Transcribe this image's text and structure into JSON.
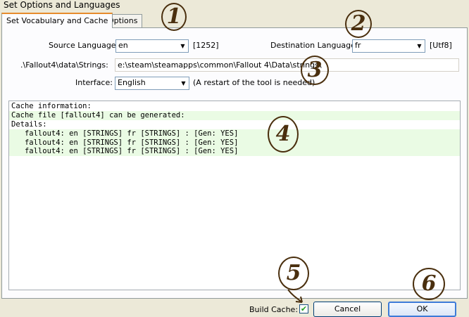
{
  "window": {
    "title": "Set Options and Languages"
  },
  "tabs": [
    {
      "label": "Set Vocabulary and Cache",
      "active": true
    },
    {
      "label": "Options",
      "active": false
    }
  ],
  "form": {
    "source_language_label": "Source Language:",
    "source_language_value": "en",
    "source_codepage": "[1252]",
    "destination_language_label": "Destination Language:",
    "destination_language_value": "fr",
    "destination_codepage": "[Utf8]",
    "strings_path_label": ".\\Fallout4\\data\\Strings:",
    "strings_path_value": "e:\\steam\\steamapps\\common\\Fallout 4\\Data\\strings\\",
    "interface_label": "Interface:",
    "interface_value": "English",
    "interface_note": "(A restart of the tool is needed)"
  },
  "cache": {
    "lines": [
      {
        "text": "Cache information:",
        "highlight": false
      },
      {
        "text": "Cache file [fallout4] can be generated:",
        "highlight": true
      },
      {
        "text": "Details:",
        "highlight": false
      },
      {
        "text": "   fallout4: en [STRINGS] fr [STRINGS] : [Gen: YES]",
        "highlight": true
      },
      {
        "text": "   fallout4: en [STRINGS] fr [STRINGS] : [Gen: YES]",
        "highlight": true
      },
      {
        "text": "   fallout4: en [STRINGS] fr [STRINGS] : [Gen: YES]",
        "highlight": true
      }
    ]
  },
  "footer": {
    "build_cache_label": "Build Cache:",
    "build_cache_checked": true,
    "cancel_label": "Cancel",
    "ok_label": "OK"
  },
  "annotations": [
    "1",
    "2",
    "3",
    "4",
    "5",
    "6"
  ],
  "colors": {
    "highlight": "#eafbe4",
    "annotation": "#4a2f0e",
    "active_tab_accent": "#e68b2c"
  }
}
